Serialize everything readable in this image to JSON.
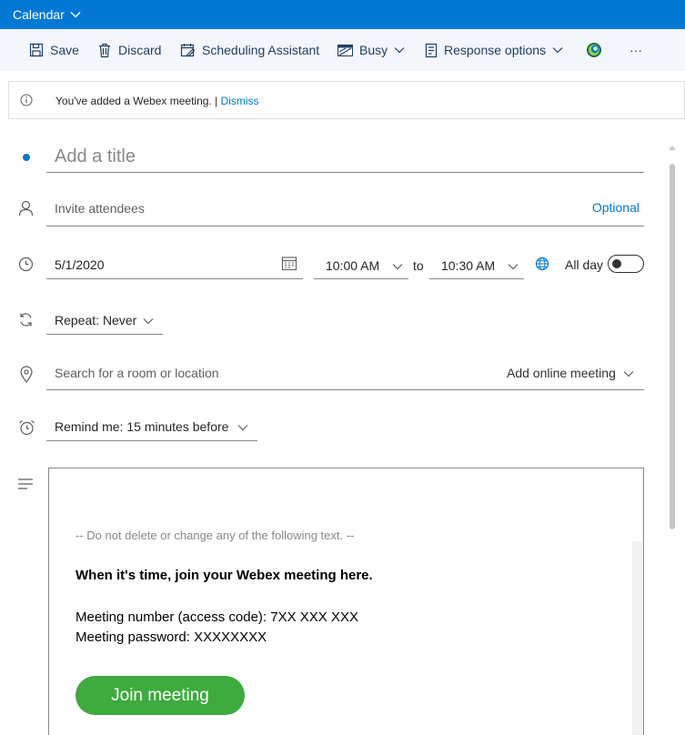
{
  "app": {
    "title": "Calendar"
  },
  "toolbar": {
    "save_label": "Save",
    "discard_label": "Discard",
    "scheduling_label": "Scheduling Assistant",
    "busy_label": "Busy",
    "response_label": "Response options",
    "more_label": "···"
  },
  "notice": {
    "message": "You've added a Webex meeting. | ",
    "dismiss_label": "Dismiss"
  },
  "form": {
    "title_placeholder": "Add a title",
    "attendees_placeholder": "Invite attendees",
    "optional_label": "Optional",
    "start_date": "5/1/2020",
    "start_time": "10:00 AM",
    "to_label": "to",
    "end_time": "10:30 AM",
    "all_day_label": "All day",
    "repeat_label": "Repeat:",
    "repeat_value": "Never",
    "location_placeholder": "Search for a room or location",
    "online_meeting_label": "Add online meeting",
    "remind_label": "Remind me:",
    "remind_value": "15 minutes before"
  },
  "body": {
    "do_not_delete": "-- Do not delete or change any of the following text. --",
    "join_heading": "When it's time, join your Webex meeting here.",
    "meeting_number": "Meeting number (access code): 7XX XXX XXX",
    "meeting_password": "Meeting password: XXXXXXXX",
    "join_button_label": "Join meeting"
  },
  "colors": {
    "brand_blue": "#0078d4",
    "join_green": "#3dab3d",
    "toolbar_bg": "#f3f6fa"
  }
}
